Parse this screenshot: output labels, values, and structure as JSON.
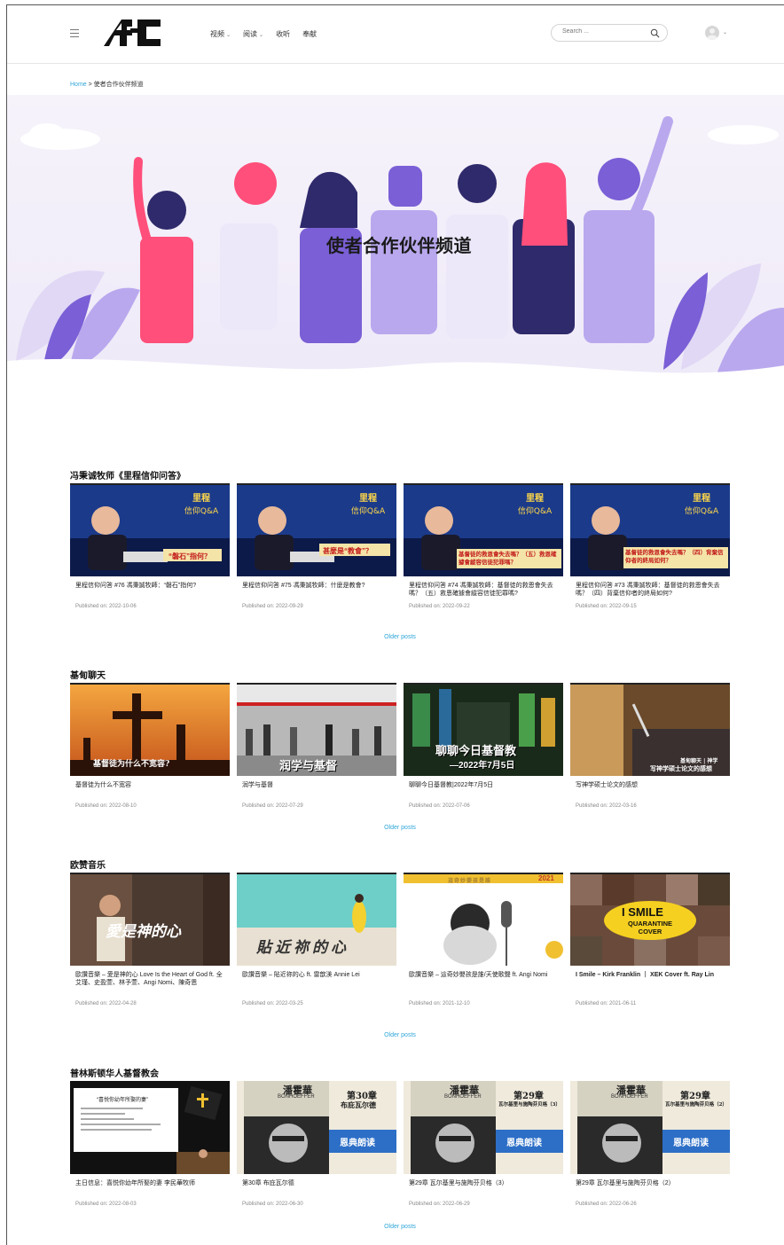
{
  "header": {
    "logo_text": "AFC",
    "nav": [
      {
        "label": "视频",
        "dropdown": true
      },
      {
        "label": "阅读",
        "dropdown": true
      },
      {
        "label": "收听",
        "dropdown": false
      },
      {
        "label": "奉献",
        "dropdown": false
      }
    ],
    "search_placeholder": "Search ..."
  },
  "breadcrumb": {
    "home": "Home",
    "separator": " > ",
    "current": "使者合作伙伴频道"
  },
  "hero": {
    "title": "使者合作伙伴频道"
  },
  "older_posts_label": "Older posts",
  "sections": [
    {
      "title": "冯秉诚牧师《里程信仰问答》",
      "posts": [
        {
          "title": "里程信仰问答 #76 馮秉誠牧師：“磐石”指何?",
          "date": "Published on: 2022-10-06",
          "overlay": "“磐石”指何？"
        },
        {
          "title": "里程信仰问答 #75 馮秉誠牧師：什麼是教會?",
          "date": "Published on: 2022-09-29",
          "overlay": "甚麼是“教會”？"
        },
        {
          "title": "里程信仰问答 #74 馮秉誠牧師：基督徒的救恩會失去嗎？（五）救恩確據會縱容信徒犯罪嗎?",
          "date": "Published on: 2022-09-22",
          "overlay": "基督徒的救恩會失去嗎？（五）救恩確據會縱容信徒犯罪嗎？"
        },
        {
          "title": "里程信仰问答 #73 馮秉誠牧師：基督徒的救恩會失去嗎？（四）背棄信仰者的終局如何?",
          "date": "Published on: 2022-09-15",
          "overlay": "基督徒的救恩會失去嗎？（四）背棄信仰者的終局如何？"
        }
      ],
      "badge": "里程 信仰Q&A"
    },
    {
      "title": "基甸聊天",
      "posts": [
        {
          "title": "基督徒为什么不宽容",
          "date": "Published on: 2022-08-10",
          "overlay": "基督徒为什么不宽容?"
        },
        {
          "title": "润学与基督",
          "date": "Published on: 2022-07-29",
          "overlay": "润学与基督"
        },
        {
          "title": "聊聊今日基督教|2022年7月5日",
          "date": "Published on: 2022-07-06",
          "overlay": "聊聊今日基督教",
          "overlay2": "—2022年7月5日"
        },
        {
          "title": "写神学硕士论文的感想",
          "date": "Published on: 2022-03-16",
          "overlay": "基甸聊天 | 神学",
          "overlay2": "写神学硕士论文的感想"
        }
      ]
    },
    {
      "title": "欧赞音乐",
      "posts": [
        {
          "title": "歐讚音樂 – 愛是神的心 Love Is the Heart of God ft. 全艾瑾、史盈萱、林予萱、Angi Nomi、陳奇恩",
          "date": "Published on: 2022-04-28",
          "overlay": "愛是神的心"
        },
        {
          "title": "歐讚音樂 – 貼近祢的心 ft. 雷歆渼 Annie Lei",
          "date": "Published on: 2022-03-25",
          "overlay": "貼近祢的心"
        },
        {
          "title": "歐讚音樂 – 這奇妙嬰孩是誰/天使歌聲 ft. Angi Nomi",
          "date": "Published on: 2021-12-10",
          "overlay": "這奇妙嬰孩是誰",
          "overlay2": "2021"
        },
        {
          "title": "I Smile – Kirk Franklin ｜ XEK Cover ft. Ray Lin",
          "date": "Published on: 2021-06-11",
          "overlay": "I SMILE",
          "overlay2": "QUARANTINE COVER"
        }
      ]
    },
    {
      "title": "普林斯顿华人基督教会",
      "posts": [
        {
          "title": "主日信息：喜悦你幼年所娶的妻 李民華牧师",
          "date": "Published on: 2022-08-03",
          "overlay": "“喜悦你幼年所娶的妻”"
        },
        {
          "title": "第30章 布庇瓦尔德",
          "date": "Published on: 2022-06-30",
          "overlay": "第30章",
          "overlay2": "布庇瓦尔德"
        },
        {
          "title": "第29章 瓦尔基里与施陶芬贝格（3）",
          "date": "Published on: 2022-06-29",
          "overlay": "第29章",
          "overlay2": "瓦尔基里与施陶芬贝格（3）"
        },
        {
          "title": "第29章 瓦尔基里与施陶芬贝格（2）",
          "date": "Published on: 2022-06-26",
          "overlay": "第29章",
          "overlay2": "瓦尔基里与施陶芬贝格（2）"
        }
      ],
      "book": {
        "name": "潘霍華",
        "latin": "BONHOEFFER",
        "band": "恩典朗读"
      }
    }
  ],
  "colors": {
    "accent": "#2fa6d9",
    "purple": "#8a6fe0",
    "pink": "#ff4f7a",
    "band_blue": "#2d6fc7"
  }
}
